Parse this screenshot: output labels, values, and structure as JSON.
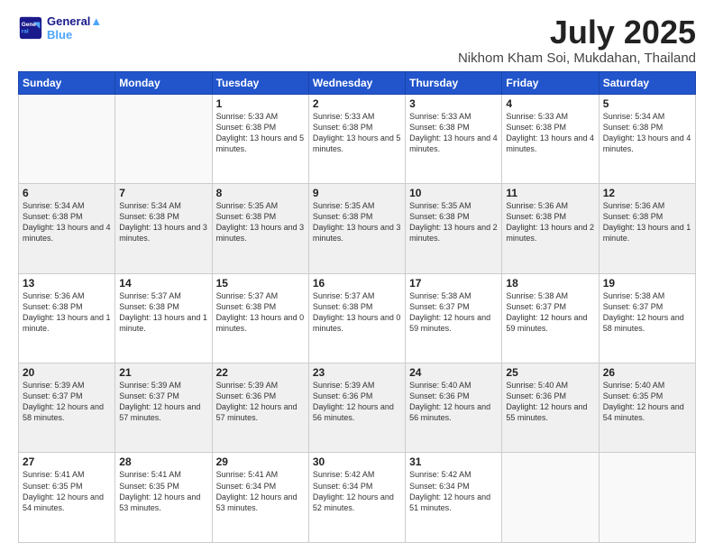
{
  "logo": {
    "line1": "General",
    "line2": "Blue"
  },
  "title": "July 2025",
  "subtitle": "Nikhom Kham Soi, Mukdahan, Thailand",
  "days_of_week": [
    "Sunday",
    "Monday",
    "Tuesday",
    "Wednesday",
    "Thursday",
    "Friday",
    "Saturday"
  ],
  "weeks": [
    [
      {
        "day": "",
        "info": ""
      },
      {
        "day": "",
        "info": ""
      },
      {
        "day": "1",
        "info": "Sunrise: 5:33 AM\nSunset: 6:38 PM\nDaylight: 13 hours and 5 minutes."
      },
      {
        "day": "2",
        "info": "Sunrise: 5:33 AM\nSunset: 6:38 PM\nDaylight: 13 hours and 5 minutes."
      },
      {
        "day": "3",
        "info": "Sunrise: 5:33 AM\nSunset: 6:38 PM\nDaylight: 13 hours and 4 minutes."
      },
      {
        "day": "4",
        "info": "Sunrise: 5:33 AM\nSunset: 6:38 PM\nDaylight: 13 hours and 4 minutes."
      },
      {
        "day": "5",
        "info": "Sunrise: 5:34 AM\nSunset: 6:38 PM\nDaylight: 13 hours and 4 minutes."
      }
    ],
    [
      {
        "day": "6",
        "info": "Sunrise: 5:34 AM\nSunset: 6:38 PM\nDaylight: 13 hours and 4 minutes."
      },
      {
        "day": "7",
        "info": "Sunrise: 5:34 AM\nSunset: 6:38 PM\nDaylight: 13 hours and 3 minutes."
      },
      {
        "day": "8",
        "info": "Sunrise: 5:35 AM\nSunset: 6:38 PM\nDaylight: 13 hours and 3 minutes."
      },
      {
        "day": "9",
        "info": "Sunrise: 5:35 AM\nSunset: 6:38 PM\nDaylight: 13 hours and 3 minutes."
      },
      {
        "day": "10",
        "info": "Sunrise: 5:35 AM\nSunset: 6:38 PM\nDaylight: 13 hours and 2 minutes."
      },
      {
        "day": "11",
        "info": "Sunrise: 5:36 AM\nSunset: 6:38 PM\nDaylight: 13 hours and 2 minutes."
      },
      {
        "day": "12",
        "info": "Sunrise: 5:36 AM\nSunset: 6:38 PM\nDaylight: 13 hours and 1 minute."
      }
    ],
    [
      {
        "day": "13",
        "info": "Sunrise: 5:36 AM\nSunset: 6:38 PM\nDaylight: 13 hours and 1 minute."
      },
      {
        "day": "14",
        "info": "Sunrise: 5:37 AM\nSunset: 6:38 PM\nDaylight: 13 hours and 1 minute."
      },
      {
        "day": "15",
        "info": "Sunrise: 5:37 AM\nSunset: 6:38 PM\nDaylight: 13 hours and 0 minutes."
      },
      {
        "day": "16",
        "info": "Sunrise: 5:37 AM\nSunset: 6:38 PM\nDaylight: 13 hours and 0 minutes."
      },
      {
        "day": "17",
        "info": "Sunrise: 5:38 AM\nSunset: 6:37 PM\nDaylight: 12 hours and 59 minutes."
      },
      {
        "day": "18",
        "info": "Sunrise: 5:38 AM\nSunset: 6:37 PM\nDaylight: 12 hours and 59 minutes."
      },
      {
        "day": "19",
        "info": "Sunrise: 5:38 AM\nSunset: 6:37 PM\nDaylight: 12 hours and 58 minutes."
      }
    ],
    [
      {
        "day": "20",
        "info": "Sunrise: 5:39 AM\nSunset: 6:37 PM\nDaylight: 12 hours and 58 minutes."
      },
      {
        "day": "21",
        "info": "Sunrise: 5:39 AM\nSunset: 6:37 PM\nDaylight: 12 hours and 57 minutes."
      },
      {
        "day": "22",
        "info": "Sunrise: 5:39 AM\nSunset: 6:36 PM\nDaylight: 12 hours and 57 minutes."
      },
      {
        "day": "23",
        "info": "Sunrise: 5:39 AM\nSunset: 6:36 PM\nDaylight: 12 hours and 56 minutes."
      },
      {
        "day": "24",
        "info": "Sunrise: 5:40 AM\nSunset: 6:36 PM\nDaylight: 12 hours and 56 minutes."
      },
      {
        "day": "25",
        "info": "Sunrise: 5:40 AM\nSunset: 6:36 PM\nDaylight: 12 hours and 55 minutes."
      },
      {
        "day": "26",
        "info": "Sunrise: 5:40 AM\nSunset: 6:35 PM\nDaylight: 12 hours and 54 minutes."
      }
    ],
    [
      {
        "day": "27",
        "info": "Sunrise: 5:41 AM\nSunset: 6:35 PM\nDaylight: 12 hours and 54 minutes."
      },
      {
        "day": "28",
        "info": "Sunrise: 5:41 AM\nSunset: 6:35 PM\nDaylight: 12 hours and 53 minutes."
      },
      {
        "day": "29",
        "info": "Sunrise: 5:41 AM\nSunset: 6:34 PM\nDaylight: 12 hours and 53 minutes."
      },
      {
        "day": "30",
        "info": "Sunrise: 5:42 AM\nSunset: 6:34 PM\nDaylight: 12 hours and 52 minutes."
      },
      {
        "day": "31",
        "info": "Sunrise: 5:42 AM\nSunset: 6:34 PM\nDaylight: 12 hours and 51 minutes."
      },
      {
        "day": "",
        "info": ""
      },
      {
        "day": "",
        "info": ""
      }
    ]
  ]
}
